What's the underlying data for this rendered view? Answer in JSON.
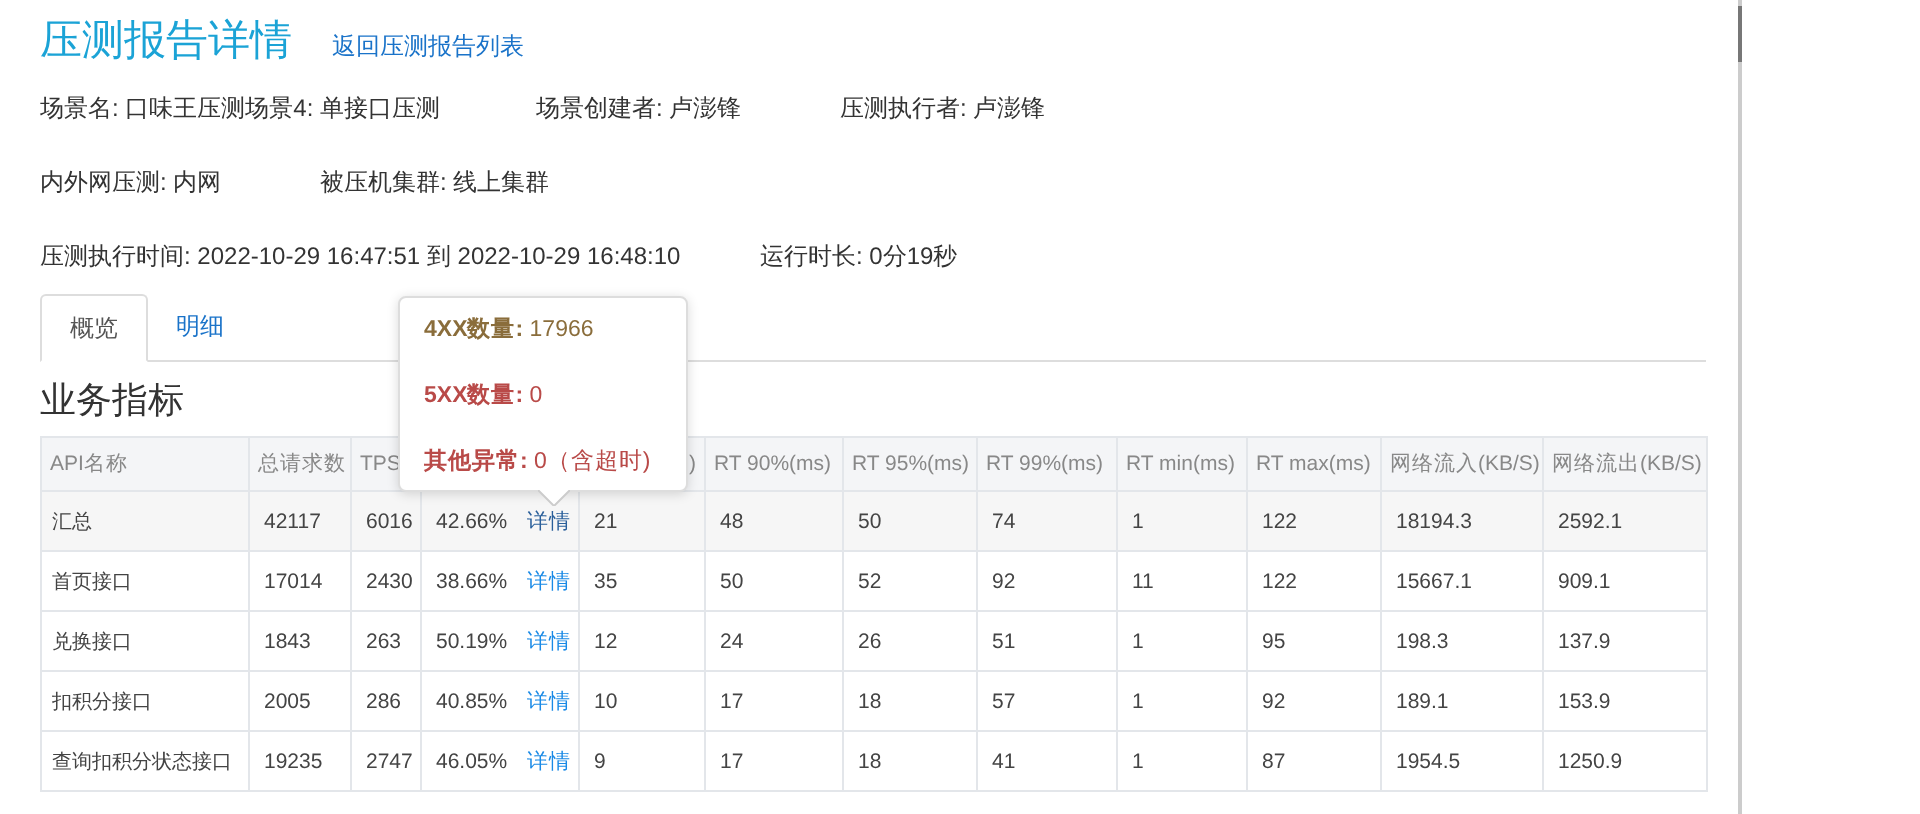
{
  "page_title": "压测报告详情",
  "back_link": "返回压测报告列表",
  "info_rows": [
    [
      {
        "text": "场景名: 口味王压测场景4: 单接口压测"
      },
      {
        "text": "场景创建者: 卢澎锋"
      },
      {
        "text": "压测执行者: 卢澎锋"
      }
    ],
    [
      {
        "text": "内外网压测: 内网"
      },
      {
        "text": "被压机集群: 线上集群"
      }
    ],
    [
      {
        "text": "压测执行时间: 2022-10-29 16:47:51 到 2022-10-29 16:48:10"
      },
      {
        "text": "运行时长: 0分19秒"
      }
    ]
  ],
  "tabs": [
    {
      "label": "概览",
      "selected": true
    },
    {
      "label": "明细",
      "selected": false
    }
  ],
  "section_title": "业务指标",
  "table": {
    "columns": [
      {
        "label": "API名称"
      },
      {
        "label": "总请求数"
      },
      {
        "label": "TPS"
      },
      {},
      {
        "label": ")"
      },
      {
        "label": "RT 90%(ms)"
      },
      {
        "label": "RT 95%(ms)"
      },
      {
        "label": "RT 99%(ms)"
      },
      {
        "label": "RT min(ms)"
      },
      {
        "label": "RT max(ms)"
      },
      {
        "label": "网络流入(KB/S)"
      },
      {
        "label": "网络流出(KB/S)"
      }
    ],
    "rows": [
      {
        "kind": "total",
        "cells": [
          "汇总",
          "42117",
          "6016",
          "42.66%",
          "21",
          "48",
          "50",
          "74",
          "1",
          "122",
          "18194.3",
          "2592.1"
        ],
        "link": "详情"
      },
      {
        "kind": "api",
        "cells": [
          "首页接口",
          "17014",
          "2430",
          "38.66%",
          "35",
          "50",
          "52",
          "92",
          "11",
          "122",
          "15667.1",
          "909.1"
        ],
        "link": "详情"
      },
      {
        "kind": "api",
        "cells": [
          "兑换接口",
          "1843",
          "263",
          "50.19%",
          "12",
          "24",
          "26",
          "51",
          "1",
          "95",
          "198.3",
          "137.9"
        ],
        "link": "详情"
      },
      {
        "kind": "api",
        "cells": [
          "扣积分接口",
          "2005",
          "286",
          "40.85%",
          "10",
          "17",
          "18",
          "57",
          "1",
          "92",
          "189.1",
          "153.9"
        ],
        "link": "详情"
      },
      {
        "kind": "api",
        "cells": [
          "查询扣积分状态接口",
          "19235",
          "2747",
          "46.05%",
          "9",
          "17",
          "18",
          "41",
          "1",
          "87",
          "1954.5",
          "1250.9"
        ],
        "link": "详情"
      }
    ]
  },
  "popover": {
    "lines": [
      {
        "label": "4XX数量:",
        "value": "17966",
        "color": "#8a6d3b"
      },
      {
        "label": "5XX数量:",
        "value": "0",
        "color": "#b94a48"
      },
      {
        "label": "其他异常:",
        "value": "0（含超时)",
        "color": "#b94a48"
      }
    ]
  }
}
